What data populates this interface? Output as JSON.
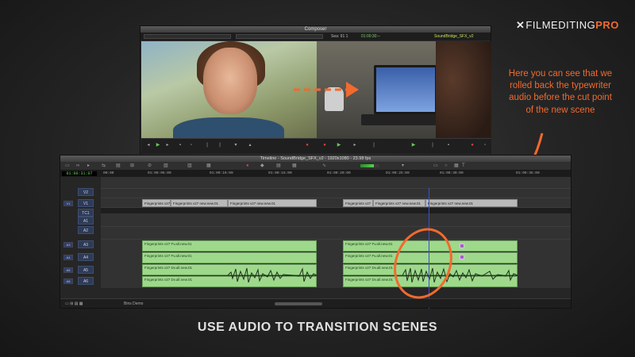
{
  "logo": {
    "x_mark": "✕",
    "part_a": "FILMEDITING",
    "part_b": "PRO"
  },
  "composer": {
    "title": "Composer",
    "sequence_name": "SoundBridge_SFX_v2",
    "sequence_timecode": "01:00:30:--",
    "top_field": "Sea: 91 1"
  },
  "timeline": {
    "title": "Timeline - SoundBridge_SFX_v2 - 1920x1080 - 23.98 fps",
    "master_timecode": "01:00:31:07",
    "ruler_ticks": [
      "00:00",
      "01:00:05:00",
      "01:00:10:00",
      "01:00:15:00",
      "01:00:20:00",
      "01:00:25:00",
      "01:00:30:00",
      "01:00:35:00"
    ],
    "tracks": [
      {
        "label": "V2",
        "patch": ""
      },
      {
        "label": "V1",
        "patch": "V1"
      },
      {
        "label": "TC1",
        "patch": ""
      },
      {
        "label": "A1",
        "patch": ""
      },
      {
        "label": "A2",
        "patch": ""
      },
      {
        "label": "A3",
        "patch": "A3"
      },
      {
        "label": "A4",
        "patch": "A4"
      },
      {
        "label": "A5",
        "patch": "A5"
      },
      {
        "label": "A6",
        "patch": "A6"
      },
      {
        "label": "TC1",
        "patch": ""
      }
    ],
    "video_clips": [
      {
        "name": "Fingerprints v27"
      },
      {
        "name": "Fingerprints v27 new.new.01"
      },
      {
        "name": "Fingerprints v27 new.new.01"
      },
      {
        "name": "Fingerprints v27"
      },
      {
        "name": "Fingerprints v27 new.new.01"
      },
      {
        "name": "Fingerprints v27 new.new.01"
      }
    ],
    "audio_clips": [
      {
        "name": "Fingerprints v27 Fv.all.new.01"
      },
      {
        "name": "Fingerprints v27 Fv.all.new.01"
      },
      {
        "name": "Fingerprints v27 Dv.all.new.01"
      },
      {
        "name": "Fingerprints v27 Dv.all.new.01"
      },
      {
        "name": "Fingerprints v27 Fv.all.new.01"
      },
      {
        "name": "Fingerprints v27 Fv.all.new.01"
      },
      {
        "name": "Fingerprints v27 Dv.all.new.01"
      },
      {
        "name": "Fingerprints v27 Dv.all.new.01"
      }
    ],
    "status": {
      "bin_label": "Bins Demo"
    }
  },
  "annotation": {
    "text": "Here you can see that we rolled back the typewriter audio before the cut point of the new scene"
  },
  "caption": "USE AUDIO TO TRANSITION SCENES",
  "colors": {
    "accent": "#f26a2e",
    "audio_clip": "#9ed98b",
    "playhead": "#3b4fd0"
  }
}
